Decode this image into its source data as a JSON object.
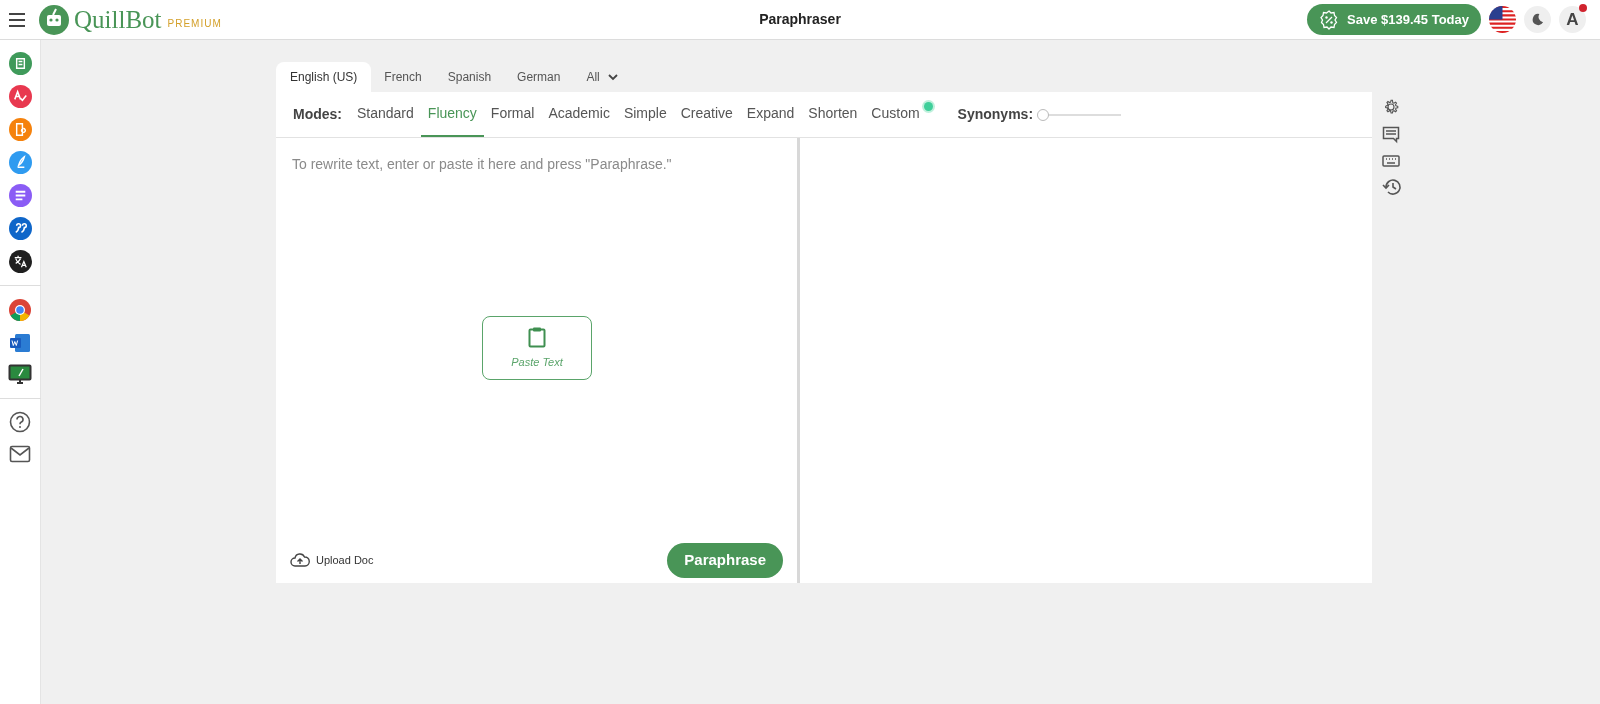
{
  "header": {
    "title": "Paraphraser",
    "brand": "QuillBot",
    "brand_tier": "PREMIUM",
    "promo_button": "Save $139.45 Today",
    "avatar_letter": "A"
  },
  "sidebar": {
    "tools": [
      {
        "color": "#3f9a5a"
      },
      {
        "color": "#e8384f"
      },
      {
        "color": "#f5820d"
      },
      {
        "color": "#2f9bf0"
      },
      {
        "color": "#8a5cf5"
      },
      {
        "color": "#0f66c9"
      },
      {
        "color": "#1f1f1f"
      }
    ]
  },
  "language_tabs": [
    {
      "label": "English (US)",
      "selected": true
    },
    {
      "label": "French",
      "selected": false
    },
    {
      "label": "Spanish",
      "selected": false
    },
    {
      "label": "German",
      "selected": false
    },
    {
      "label": "All",
      "selected": false
    }
  ],
  "modes": {
    "label": "Modes:",
    "items": [
      {
        "label": "Standard",
        "selected": false
      },
      {
        "label": "Fluency",
        "selected": true
      },
      {
        "label": "Formal",
        "selected": false
      },
      {
        "label": "Academic",
        "selected": false
      },
      {
        "label": "Simple",
        "selected": false
      },
      {
        "label": "Creative",
        "selected": false
      },
      {
        "label": "Expand",
        "selected": false
      },
      {
        "label": "Shorten",
        "selected": false
      },
      {
        "label": "Custom",
        "selected": false
      }
    ]
  },
  "synonyms": {
    "label": "Synonyms:",
    "level": 0
  },
  "editor": {
    "placeholder": "To rewrite text, enter or paste it here and press \"Paraphrase.\"",
    "paste_button": "Paste Text",
    "upload_button": "Upload Doc",
    "paraphrase_button": "Paraphrase"
  }
}
